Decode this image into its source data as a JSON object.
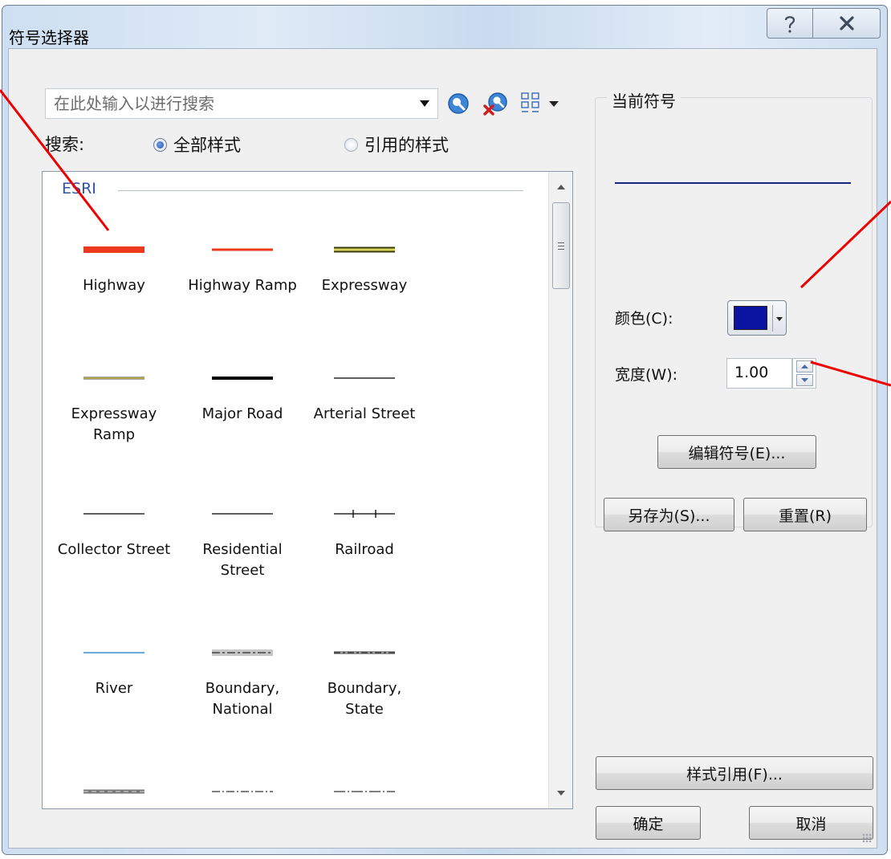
{
  "window": {
    "title": "符号选择器"
  },
  "search": {
    "placeholder": "在此处输入以进行搜索"
  },
  "search_scope": {
    "label": "搜索:",
    "options": [
      {
        "label": "全部样式",
        "selected": true
      },
      {
        "label": "引用的样式",
        "selected": false
      }
    ]
  },
  "symbols": {
    "group_name": "ESRI",
    "items": [
      {
        "label": "Highway",
        "style": "thick-red",
        "color": "#ee3a1c"
      },
      {
        "label": "Highway Ramp",
        "style": "red",
        "color": "#ee3a1c"
      },
      {
        "label": "Expressway",
        "style": "cased-yellow",
        "color": "#d6d65a"
      },
      {
        "label": "Expressway\nRamp",
        "style": "thin-yellow",
        "color": "#d9c84a"
      },
      {
        "label": "Major Road",
        "style": "thick-black",
        "color": "#000000"
      },
      {
        "label": "Arterial Street",
        "style": "thin-black",
        "color": "#000000"
      },
      {
        "label": "Collector Street",
        "style": "thin-black",
        "color": "#000000"
      },
      {
        "label": "Residential\nStreet",
        "style": "thin-black",
        "color": "#000000"
      },
      {
        "label": "Railroad",
        "style": "railroad",
        "color": "#000000"
      },
      {
        "label": "River",
        "style": "thin-blue",
        "color": "#3a8ed8"
      },
      {
        "label": "Boundary,\nNational",
        "style": "boundary-national",
        "color": "#8f8f8f"
      },
      {
        "label": "Boundary,\nState",
        "style": "boundary-state",
        "color": "#555555"
      },
      {
        "label": "",
        "style": "boundary-gray",
        "color": "#888888"
      },
      {
        "label": "",
        "style": "dash-dot",
        "color": "#555555"
      },
      {
        "label": "",
        "style": "dash-dot-long",
        "color": "#555555"
      }
    ]
  },
  "current_symbol": {
    "title": "当前符号",
    "preview_color": "#1a237e",
    "color_label": "颜色(C):",
    "color_value": "#0a14a0",
    "width_label": "宽度(W):",
    "width_value": "1.00",
    "edit_button": "编辑符号(E)...",
    "save_as_button": "另存为(S)...",
    "reset_button": "重置(R)"
  },
  "buttons": {
    "style_references": "样式引用(F)...",
    "ok": "确定",
    "cancel": "取消"
  },
  "annotation_color": "#ee0000"
}
